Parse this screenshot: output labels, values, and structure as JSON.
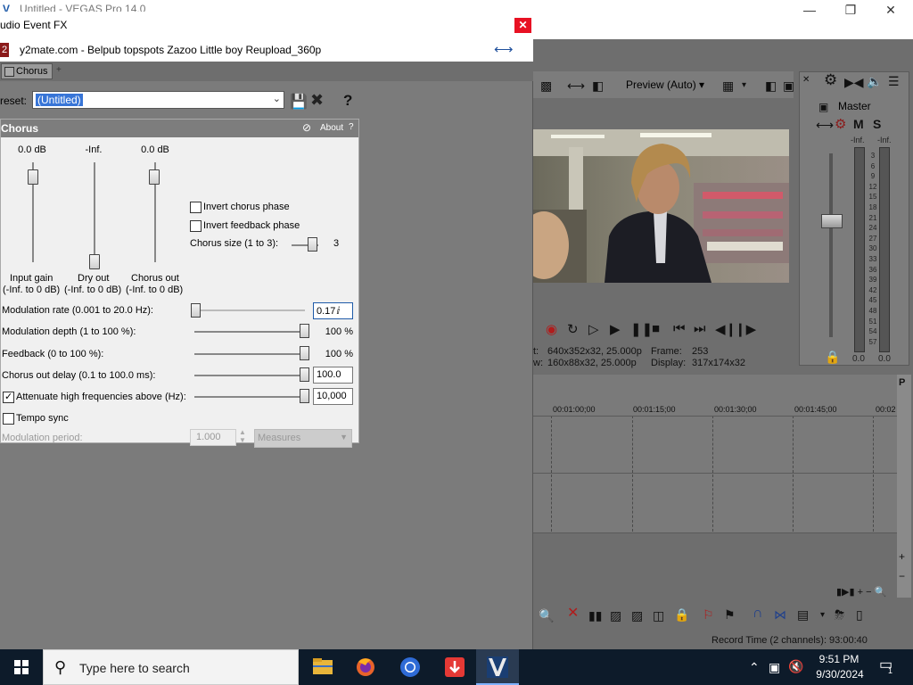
{
  "vegas": {
    "title": "Untitled - VEGAS Pro 14.0",
    "preview": {
      "mode": "Preview (Auto)",
      "info_project": "t:",
      "info_project_val": "640x352x32, 25.000p",
      "info_preview": "w:",
      "info_preview_val": "160x88x32, 25.000p",
      "frame_label": "Frame:",
      "frame_val": "253",
      "display_label": "Display:",
      "display_val": "317x174x32"
    },
    "master": {
      "label": "Master",
      "mute": "M",
      "solo": "S",
      "meter_top_l": "-Inf.",
      "meter_top_r": "-Inf.",
      "meter_bottom_l": "0.0",
      "meter_bottom_r": "0.0",
      "scale": [
        "3",
        "6",
        "9",
        "12",
        "15",
        "18",
        "21",
        "24",
        "27",
        "30",
        "33",
        "36",
        "39",
        "42",
        "45",
        "48",
        "51",
        "54",
        "57"
      ]
    },
    "timeline": {
      "ruler": [
        "00:01:00;00",
        "00:01:15;00",
        "00:01:30;00",
        "00:01:45;00",
        "00:02"
      ]
    },
    "status": "Record Time (2 channels): 93:00:40"
  },
  "fx": {
    "title": "udio Event FX",
    "badge": "2",
    "event_name": "y2mate.com - Belpub topspots Zazoo  Little boy Reupload_360p",
    "chain_tab": "Chorus",
    "chain_plus": "+",
    "preset_label": "reset:",
    "preset_value": "(Untitled)",
    "help": "?",
    "plugin": {
      "name": "Chorus",
      "about": "About",
      "q": "?",
      "sliders": [
        {
          "value": "0.0 dB",
          "name": "Input gain",
          "range": "(-Inf. to 0 dB)"
        },
        {
          "value": "-Inf.",
          "name": "Dry out",
          "range": "(-Inf. to 0 dB)"
        },
        {
          "value": "0.0 dB",
          "name": "Chorus out",
          "range": "(-Inf. to 0 dB)"
        }
      ],
      "invert_chorus": "Invert chorus phase",
      "invert_feedback": "Invert feedback phase",
      "chorus_size_label": "Chorus size (1 to 3):",
      "chorus_size_value": "3",
      "mod_rate_label": "Modulation rate (0.001 to 20.0 Hz):",
      "mod_rate_value": "0.17",
      "mod_depth_label": "Modulation depth (1 to 100 %):",
      "mod_depth_value": "100 %",
      "feedback_label": "Feedback (0 to 100 %):",
      "feedback_value": "100 %",
      "delay_label": "Chorus out delay (0.1 to 100.0 ms):",
      "delay_value": "100.0",
      "attenuate_label": "Attenuate high frequencies above (Hz):",
      "attenuate_value": "10,000",
      "tempo_sync": "Tempo sync",
      "mod_period_label": "Modulation period:",
      "mod_period_value": "1.000",
      "mod_period_units": "Measures"
    }
  },
  "taskbar": {
    "search_placeholder": "Type here to search",
    "time": "9:51 PM",
    "date": "9/30/2024",
    "notif_count": "1"
  }
}
